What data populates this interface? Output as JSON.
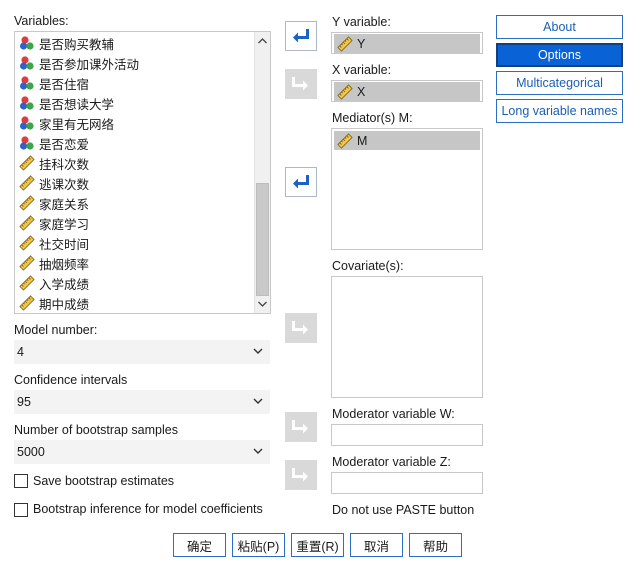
{
  "variables": {
    "label": "Variables:",
    "items": [
      {
        "name": "是否购买教辅",
        "type": "nominal"
      },
      {
        "name": "是否参加课外活动",
        "type": "nominal"
      },
      {
        "name": "是否住宿",
        "type": "nominal"
      },
      {
        "name": "是否想读大学",
        "type": "nominal"
      },
      {
        "name": "家里有无网络",
        "type": "nominal"
      },
      {
        "name": "是否恋爱",
        "type": "nominal"
      },
      {
        "name": "挂科次数",
        "type": "scale"
      },
      {
        "name": "逃课次数",
        "type": "scale"
      },
      {
        "name": "家庭关系",
        "type": "scale"
      },
      {
        "name": "家庭学习",
        "type": "scale"
      },
      {
        "name": "社交时间",
        "type": "scale"
      },
      {
        "name": "抽烟频率",
        "type": "scale"
      },
      {
        "name": "入学成绩",
        "type": "scale"
      },
      {
        "name": "期中成绩",
        "type": "scale"
      }
    ]
  },
  "model_number": {
    "label": "Model number:",
    "value": "4"
  },
  "confidence_intervals": {
    "label": "Confidence intervals",
    "value": "95"
  },
  "bootstrap_samples": {
    "label": "Number of bootstrap samples",
    "value": "5000"
  },
  "checkboxes": {
    "save_bootstrap": {
      "label": "Save bootstrap estimates",
      "checked": false
    },
    "bootstrap_inference": {
      "label": "Bootstrap inference for model coefficients",
      "checked": false
    }
  },
  "targets": {
    "y": {
      "label": "Y variable:",
      "value": "Y"
    },
    "x": {
      "label": "X variable:",
      "value": "X"
    },
    "mediators": {
      "label": "Mediator(s) M:",
      "items": [
        "M"
      ]
    },
    "covariates": {
      "label": "Covariate(s):"
    },
    "moderator_w": {
      "label": "Moderator variable W:"
    },
    "moderator_z": {
      "label": "Moderator variable Z:"
    },
    "paste_note": "Do not use PASTE button"
  },
  "side_buttons": {
    "about": "About",
    "options": "Options",
    "multicategorical": "Multicategorical",
    "long_names": "Long variable names"
  },
  "bottom_buttons": {
    "ok": "确定",
    "paste": "粘贴(P)",
    "reset": "重置(R)",
    "cancel": "取消",
    "help": "帮助"
  },
  "colors": {
    "accent": "#0a63d6",
    "link_border": "#2a6fc4",
    "selected_bg": "#c6c6c6",
    "disabled_btn": "#d9d9d9",
    "arrow_blue": "#1a62c6"
  }
}
